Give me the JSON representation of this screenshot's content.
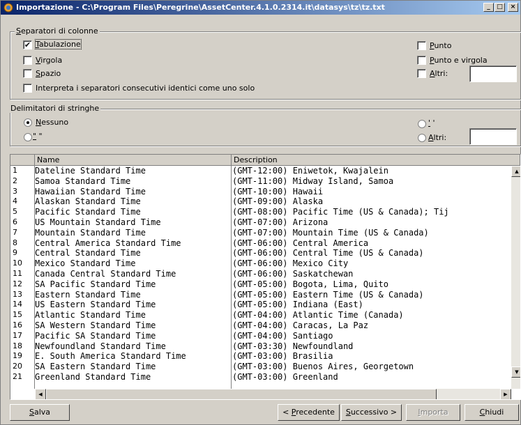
{
  "window": {
    "title": "Importazione - C:\\Program Files\\Peregrine\\AssetCenter.4.1.0.2314.it\\datasys\\tz\\tz.txt",
    "controls": {
      "minimize": "_",
      "maximize": "□",
      "close": "×"
    }
  },
  "column_separators": {
    "legend_prefix": "S",
    "legend_rest": "eparatori di colonne",
    "tab": {
      "accel": "T",
      "rest": "abulazione",
      "checked": true
    },
    "comma": {
      "accel": "V",
      "rest": "irgola",
      "checked": false
    },
    "space": {
      "accel": "S",
      "rest": "pazio",
      "checked": false
    },
    "consecutive": {
      "label": "Interpreta i separatori consecutivi identici come uno solo",
      "checked": false
    },
    "point": {
      "accel": "P",
      "rest": "unto",
      "checked": false
    },
    "semicolon": {
      "accel": "P",
      "rest": "unto e virgola",
      "checked": false
    },
    "others": {
      "accel": "A",
      "rest": "ltri:",
      "checked": false,
      "value": ""
    }
  },
  "string_delimiters": {
    "legend": "Delimitatori di stringhe",
    "none": {
      "accel": "N",
      "rest": "essuno",
      "selected": true
    },
    "double_quote": {
      "accel": "\"",
      "rest": " \"",
      "selected": false
    },
    "single_quote": {
      "accel": "'",
      "rest": " '",
      "selected": false
    },
    "others": {
      "accel": "A",
      "rest": "ltri:",
      "selected": false,
      "value": ""
    }
  },
  "table": {
    "headers": {
      "name": "Name",
      "description": "Description"
    },
    "rows": [
      {
        "n": "1",
        "name": "Dateline Standard Time",
        "desc": "(GMT-12:00) Eniwetok, Kwajalein"
      },
      {
        "n": "2",
        "name": "Samoa Standard Time",
        "desc": "(GMT-11:00) Midway Island, Samoa"
      },
      {
        "n": "3",
        "name": "Hawaiian Standard Time",
        "desc": "(GMT-10:00) Hawaii"
      },
      {
        "n": "4",
        "name": "Alaskan Standard Time",
        "desc": "(GMT-09:00) Alaska"
      },
      {
        "n": "5",
        "name": "Pacific Standard Time",
        "desc": "(GMT-08:00) Pacific Time (US & Canada); Tij"
      },
      {
        "n": "6",
        "name": "US Mountain Standard Time",
        "desc": "(GMT-07:00) Arizona"
      },
      {
        "n": "7",
        "name": "Mountain Standard Time",
        "desc": "(GMT-07:00) Mountain Time (US & Canada)"
      },
      {
        "n": "8",
        "name": "Central America Standard Time",
        "desc": "(GMT-06:00) Central America"
      },
      {
        "n": "9",
        "name": "Central Standard Time",
        "desc": "(GMT-06:00) Central Time (US & Canada)"
      },
      {
        "n": "10",
        "name": "Mexico Standard Time",
        "desc": "(GMT-06:00) Mexico City"
      },
      {
        "n": "11",
        "name": "Canada Central Standard Time",
        "desc": "(GMT-06:00) Saskatchewan"
      },
      {
        "n": "12",
        "name": "SA Pacific Standard Time",
        "desc": "(GMT-05:00) Bogota, Lima, Quito"
      },
      {
        "n": "13",
        "name": "Eastern Standard Time",
        "desc": "(GMT-05:00) Eastern Time (US & Canada)"
      },
      {
        "n": "14",
        "name": "US Eastern Standard Time",
        "desc": "(GMT-05:00) Indiana (East)"
      },
      {
        "n": "15",
        "name": "Atlantic Standard Time",
        "desc": "(GMT-04:00) Atlantic Time (Canada)"
      },
      {
        "n": "16",
        "name": "SA Western Standard Time",
        "desc": "(GMT-04:00) Caracas, La Paz"
      },
      {
        "n": "17",
        "name": "Pacific SA Standard Time",
        "desc": "(GMT-04:00) Santiago"
      },
      {
        "n": "18",
        "name": "Newfoundland Standard Time",
        "desc": "(GMT-03:30) Newfoundland"
      },
      {
        "n": "19",
        "name": "E. South America Standard Time",
        "desc": "(GMT-03:00) Brasilia"
      },
      {
        "n": "20",
        "name": "SA Eastern Standard Time",
        "desc": "(GMT-03:00) Buenos Aires, Georgetown"
      },
      {
        "n": "21",
        "name": "Greenland Standard Time",
        "desc": "(GMT-03:00) Greenland"
      }
    ]
  },
  "buttons": {
    "save": {
      "accel": "S",
      "rest": "alva"
    },
    "previous": {
      "prefix": "< ",
      "accel": "P",
      "rest": "recedente"
    },
    "next": {
      "accel": "S",
      "rest": "uccessivo >"
    },
    "import": {
      "accel": "I",
      "rest": "mporta",
      "disabled": true
    },
    "close": {
      "accel": "C",
      "rest": "hiudi"
    }
  },
  "colors": {
    "face": "#d4d0c8",
    "title_start": "#0a246a",
    "title_end": "#a6caf0",
    "shadow": "#808080"
  }
}
